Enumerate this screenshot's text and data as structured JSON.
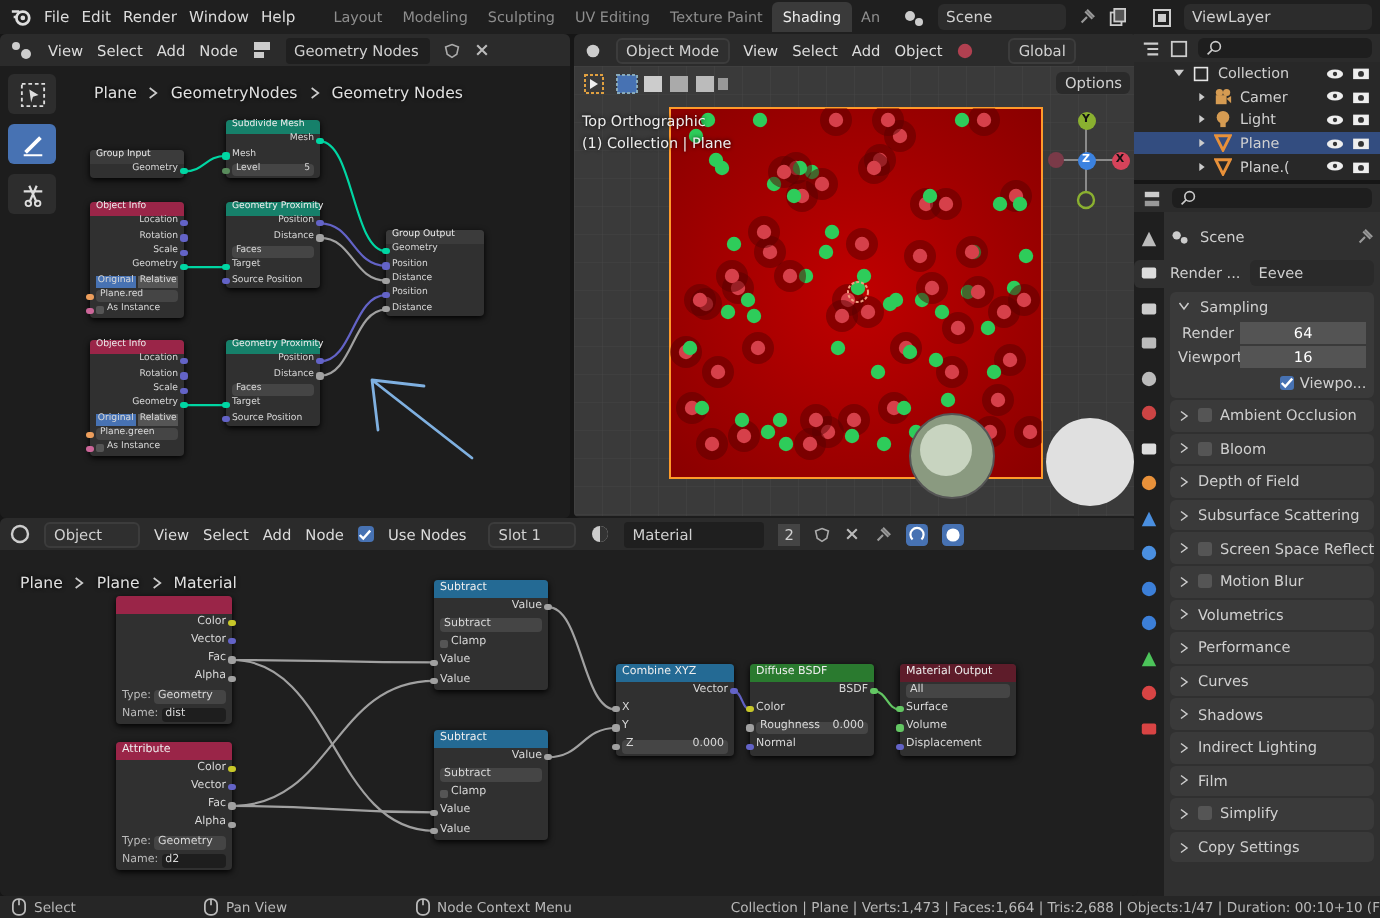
{
  "topbar": {
    "menus": [
      "File",
      "Edit",
      "Render",
      "Window",
      "Help"
    ],
    "workspaces": [
      {
        "label": "Layout",
        "selected": false
      },
      {
        "label": "Modeling",
        "selected": false
      },
      {
        "label": "Sculpting",
        "selected": false
      },
      {
        "label": "UV Editing",
        "selected": false
      },
      {
        "label": "Texture Paint",
        "selected": false
      },
      {
        "label": "Shading",
        "selected": true
      },
      {
        "label": "An",
        "selected": false
      }
    ],
    "scene": "Scene",
    "view_layer": "ViewLayer"
  },
  "geometry_editor": {
    "menus": [
      "View",
      "Select",
      "Add",
      "Node"
    ],
    "node_group": "Geometry Nodes",
    "breadcrumb": [
      "Plane",
      "GeometryNodes",
      "Geometry Nodes"
    ],
    "tools": [
      {
        "kind": "select",
        "selected": false
      },
      {
        "kind": "annotate",
        "selected": true
      },
      {
        "kind": "cut",
        "selected": false
      }
    ],
    "nodes": [
      {
        "title": "Group Input",
        "color": "#3b3b3b",
        "rows": [
          {
            "kind": "output",
            "label": "Geometry",
            "color": "#00d6a3"
          }
        ]
      },
      {
        "title": "Subdivide Mesh",
        "color": "#16806a",
        "rows": [
          {
            "kind": "output",
            "label": "Mesh",
            "color": "#00d6a3"
          },
          {
            "kind": "input",
            "label": "Mesh",
            "color": "#00d6a3"
          },
          {
            "kind": "field",
            "label": "Level",
            "value": "5",
            "color": "#598c5c"
          }
        ]
      },
      {
        "title": "Object Info",
        "color": "#9a2548",
        "rows": [
          {
            "kind": "output",
            "label": "Location",
            "color": "#6363c7"
          },
          {
            "kind": "output",
            "label": "Rotation",
            "color": "#6363c7"
          },
          {
            "kind": "output",
            "label": "Scale",
            "color": "#6363c7"
          },
          {
            "kind": "output",
            "label": "Geometry",
            "color": "#00d6a3"
          },
          {
            "kind": "toggle",
            "options": [
              {
                "label": "Original",
                "selected": true
              },
              {
                "label": "Relative",
                "selected": false
              }
            ]
          },
          {
            "kind": "object",
            "value": "Plane.red",
            "color": "#ed9e5c"
          },
          {
            "kind": "checkbox",
            "label": "As Instance",
            "checked": false,
            "color": "#cc6699"
          }
        ]
      },
      {
        "title": "Geometry Proximity",
        "color": "#16806a",
        "rows": [
          {
            "kind": "output",
            "label": "Position",
            "color": "#6363c7"
          },
          {
            "kind": "output",
            "label": "Distance",
            "color": "#a1a1a1"
          },
          {
            "kind": "dropdown",
            "value": "Faces"
          },
          {
            "kind": "input",
            "label": "Target",
            "color": "#00d6a3"
          },
          {
            "kind": "input",
            "label": "Source Position",
            "color": "#6363c7"
          }
        ]
      },
      {
        "title": "Group Output",
        "color": "#3b3b3b",
        "rows": [
          {
            "kind": "input",
            "label": "Geometry",
            "color": "#00d6a3"
          },
          {
            "kind": "input",
            "label": "Position",
            "color": "#6363c7"
          },
          {
            "kind": "input",
            "label": "Distance",
            "color": "#a1a1a1"
          },
          {
            "kind": "input",
            "label": "Position",
            "color": "#6363c7"
          },
          {
            "kind": "input",
            "label": "Distance",
            "color": "#a1a1a1"
          }
        ]
      },
      {
        "title": "Object Info",
        "color": "#9a2548",
        "rows": [
          {
            "kind": "output",
            "label": "Location",
            "color": "#6363c7"
          },
          {
            "kind": "output",
            "label": "Rotation",
            "color": "#6363c7"
          },
          {
            "kind": "output",
            "label": "Scale",
            "color": "#6363c7"
          },
          {
            "kind": "output",
            "label": "Geometry",
            "color": "#00d6a3"
          },
          {
            "kind": "toggle",
            "options": [
              {
                "label": "Original",
                "selected": true
              },
              {
                "label": "Relative",
                "selected": false
              }
            ]
          },
          {
            "kind": "object",
            "value": "Plane.green",
            "color": "#ed9e5c"
          },
          {
            "kind": "checkbox",
            "label": "As Instance",
            "checked": false,
            "color": "#cc6699"
          }
        ]
      },
      {
        "title": "Geometry Proximity",
        "color": "#16806a",
        "rows": [
          {
            "kind": "output",
            "label": "Position",
            "color": "#6363c7"
          },
          {
            "kind": "output",
            "label": "Distance",
            "color": "#a1a1a1"
          },
          {
            "kind": "dropdown",
            "value": "Faces"
          },
          {
            "kind": "input",
            "label": "Target",
            "color": "#00d6a3"
          },
          {
            "kind": "input",
            "label": "Source Position",
            "color": "#6363c7"
          }
        ]
      }
    ]
  },
  "viewport": {
    "mode": "Object Mode",
    "menus": [
      "View",
      "Select",
      "Add",
      "Object"
    ],
    "orientation": "Global",
    "options": "Options",
    "view_name": "Top Orthographic",
    "context": "(1) Collection | Plane",
    "gizmo_axes": [
      "Y",
      "Z",
      "X"
    ]
  },
  "outliner": {
    "items": [
      {
        "label": "Collection",
        "kind": "collection",
        "selected": false,
        "children": [
          {
            "label": "Camer",
            "kind": "camera",
            "selected": false
          },
          {
            "label": "Light",
            "kind": "light",
            "selected": false
          },
          {
            "label": "Plane",
            "kind": "mesh",
            "selected": true
          },
          {
            "label": "Plane.(",
            "kind": "mesh",
            "selected": false
          }
        ]
      }
    ]
  },
  "properties": {
    "tabs": [
      {
        "kind": "tool",
        "selected": false
      },
      {
        "kind": "render",
        "selected": true
      },
      {
        "kind": "output",
        "selected": false
      },
      {
        "kind": "view_layer",
        "selected": false
      },
      {
        "kind": "scene",
        "selected": false
      },
      {
        "kind": "world",
        "selected": false
      },
      {
        "kind": "collection",
        "selected": false
      },
      {
        "kind": "object",
        "selected": false
      },
      {
        "kind": "modifiers",
        "selected": false
      },
      {
        "kind": "particles",
        "selected": false
      },
      {
        "kind": "physics",
        "selected": false
      },
      {
        "kind": "constraints",
        "selected": false
      },
      {
        "kind": "data",
        "selected": false
      },
      {
        "kind": "material",
        "selected": false
      },
      {
        "kind": "texture",
        "selected": false
      }
    ],
    "context": "Scene",
    "engine_label": "Render ...",
    "engine": "Eevee",
    "sampling": {
      "title": "Sampling",
      "expanded": true,
      "render": {
        "label": "Render",
        "value": "64"
      },
      "viewport": {
        "label": "Viewport",
        "value": "16"
      },
      "denoise": {
        "label": "Viewpo...",
        "checked": true
      }
    },
    "panels": [
      {
        "label": "Ambient Occlusion",
        "kind": "toggle",
        "checked": false
      },
      {
        "label": "Bloom",
        "kind": "toggle",
        "checked": false
      },
      {
        "label": "Depth of Field",
        "kind": "plain"
      },
      {
        "label": "Subsurface Scattering",
        "kind": "plain"
      },
      {
        "label": "Screen Space Reflect",
        "kind": "toggle",
        "checked": false
      },
      {
        "label": "Motion Blur",
        "kind": "toggle",
        "checked": false
      },
      {
        "label": "Volumetrics",
        "kind": "plain"
      },
      {
        "label": "Performance",
        "kind": "plain"
      },
      {
        "label": "Curves",
        "kind": "plain"
      },
      {
        "label": "Shadows",
        "kind": "plain"
      },
      {
        "label": "Indirect Lighting",
        "kind": "plain"
      },
      {
        "label": "Film",
        "kind": "plain"
      },
      {
        "label": "Simplify",
        "kind": "toggle",
        "checked": false
      },
      {
        "label": "Copy Settings",
        "kind": "plain"
      }
    ]
  },
  "shader_editor": {
    "object_mode": "Object",
    "menus": [
      "View",
      "Select",
      "Add",
      "Node"
    ],
    "use_nodes": {
      "label": "Use Nodes",
      "checked": true
    },
    "slot": "Slot 1",
    "material": "Material",
    "users": "2",
    "breadcrumb": [
      "Plane",
      "Plane",
      "Material"
    ],
    "nodes": [
      {
        "color": "#9a2548",
        "rows": [
          {
            "kind": "output",
            "label": "Color",
            "color": "#c7c729"
          },
          {
            "kind": "output",
            "label": "Vector",
            "color": "#6363c7"
          },
          {
            "kind": "output",
            "label": "Fac",
            "color": "#a1a1a1"
          },
          {
            "kind": "output",
            "label": "Alpha",
            "color": "#a1a1a1"
          },
          {
            "kind": "dropdown",
            "label": "Type:",
            "value": "Geometry"
          },
          {
            "kind": "text_field",
            "label": "Name:",
            "value": "dist"
          }
        ]
      },
      {
        "title": "Attribute",
        "color": "#9a2548",
        "rows": [
          {
            "kind": "output",
            "label": "Color",
            "color": "#c7c729"
          },
          {
            "kind": "output",
            "label": "Vector",
            "color": "#6363c7"
          },
          {
            "kind": "output",
            "label": "Fac",
            "color": "#a1a1a1"
          },
          {
            "kind": "output",
            "label": "Alpha",
            "color": "#a1a1a1"
          },
          {
            "kind": "dropdown",
            "label": "Type:",
            "value": "Geometry"
          },
          {
            "kind": "text_field",
            "label": "Name:",
            "value": "d2"
          }
        ]
      },
      {
        "title": "Subtract",
        "color": "#246a94",
        "rows": [
          {
            "kind": "output",
            "label": "Value",
            "color": "#a1a1a1"
          },
          {
            "kind": "dropdown",
            "value": "Subtract"
          },
          {
            "kind": "checkbox",
            "label": "Clamp",
            "checked": false
          },
          {
            "kind": "input",
            "label": "Value",
            "color": "#a1a1a1"
          },
          {
            "kind": "input",
            "label": "Value",
            "color": "#a1a1a1"
          }
        ]
      },
      {
        "title": "Subtract",
        "color": "#246a94",
        "rows": [
          {
            "kind": "output",
            "label": "Value",
            "color": "#a1a1a1"
          },
          {
            "kind": "dropdown",
            "value": "Subtract"
          },
          {
            "kind": "checkbox",
            "label": "Clamp",
            "checked": false
          },
          {
            "kind": "input",
            "label": "Value",
            "color": "#a1a1a1"
          },
          {
            "kind": "input",
            "label": "Value",
            "color": "#a1a1a1"
          }
        ]
      },
      {
        "title": "Combine XYZ",
        "color": "#246a94",
        "rows": [
          {
            "kind": "output",
            "label": "Vector",
            "color": "#6363c7"
          },
          {
            "kind": "input",
            "label": "X",
            "color": "#a1a1a1"
          },
          {
            "kind": "input",
            "label": "Y",
            "color": "#a1a1a1"
          },
          {
            "kind": "field",
            "label": "Z",
            "value": "0.000",
            "color": "#a1a1a1"
          }
        ]
      },
      {
        "title": "Diffuse BSDF",
        "color": "#2a7a2f",
        "rows": [
          {
            "kind": "output",
            "label": "BSDF",
            "color": "#63c763"
          },
          {
            "kind": "input",
            "label": "Color",
            "color": "#c7c729"
          },
          {
            "kind": "field",
            "label": "Roughness",
            "value": "0.000",
            "color": "#a1a1a1"
          },
          {
            "kind": "input",
            "label": "Normal",
            "color": "#6363c7"
          }
        ]
      },
      {
        "title": "Material Output",
        "color": "#5e1c2a",
        "rows": [
          {
            "kind": "dropdown",
            "value": "All"
          },
          {
            "kind": "input",
            "label": "Surface",
            "color": "#63c763"
          },
          {
            "kind": "input",
            "label": "Volume",
            "color": "#63c763"
          },
          {
            "kind": "input",
            "label": "Displacement",
            "color": "#6363c7"
          }
        ]
      }
    ]
  },
  "status_bar": {
    "hints": [
      "Select",
      "Pan View",
      "Node Context Menu"
    ],
    "stats": "Collection | Plane | Verts:1,473 | Faces:1,664 | Tris:2,688 | Objects:1/47 | Duration: 00:10+10 (F"
  }
}
